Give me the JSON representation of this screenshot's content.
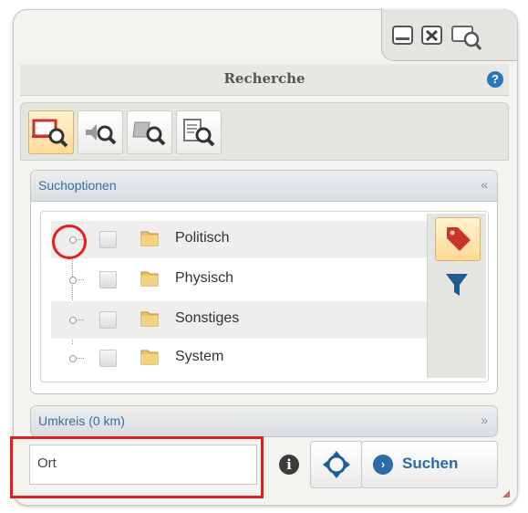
{
  "window": {
    "title": "Recherche",
    "help_label": "?",
    "controls": [
      "minimize-icon",
      "close-icon",
      "search-window-icon"
    ]
  },
  "toolbar": {
    "tools": [
      {
        "name": "map-search",
        "active": true
      },
      {
        "name": "audio-search",
        "active": false
      },
      {
        "name": "book-search",
        "active": false
      },
      {
        "name": "document-search",
        "active": false
      }
    ]
  },
  "search_options": {
    "title": "Suchoptionen",
    "toggle": "«",
    "items": [
      {
        "label": "Politisch",
        "checked": false
      },
      {
        "label": "Physisch",
        "checked": false
      },
      {
        "label": "Sonstiges",
        "checked": false
      },
      {
        "label": "System",
        "checked": false
      }
    ],
    "side_buttons": [
      "tag-icon",
      "filter-icon"
    ]
  },
  "radius": {
    "title": "Umkreis (0 km)",
    "toggle": "»"
  },
  "search": {
    "value": "Ort",
    "info_label": "i",
    "button_label": "Suchen",
    "button_icon": "›"
  },
  "colors": {
    "accent": "#2c6aa8",
    "highlight": "#e02020",
    "active": "#ffd995"
  }
}
